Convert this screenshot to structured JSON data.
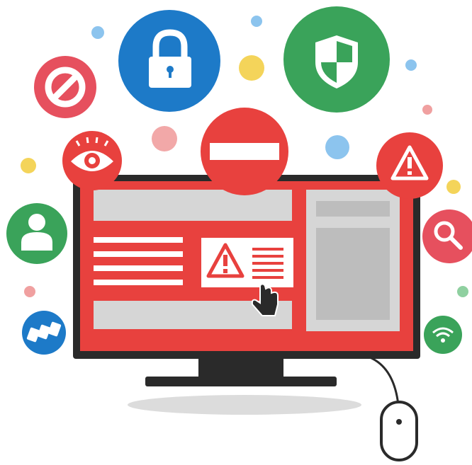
{
  "scene": {
    "subject": "computer-security-illustration",
    "colors": {
      "red": "#e8413e",
      "dark_red": "#d42f2e",
      "pink": "#e6505e",
      "blue": "#1d7ac8",
      "green": "#3aa35a",
      "monitor": "#2a2a2a",
      "panel_gray": "#d6d6d6",
      "inner_gray": "#bdbdbd",
      "yellow": "#f4d45a",
      "light_blue": "#8cc4ee"
    },
    "icons": [
      "lock-icon",
      "shield-icon",
      "prohibited-icon",
      "no-entry-icon",
      "eye-icon",
      "warning-icon",
      "user-icon",
      "search-icon",
      "card-icon",
      "wifi-icon",
      "cursor-hand-icon",
      "mouse-icon"
    ]
  }
}
